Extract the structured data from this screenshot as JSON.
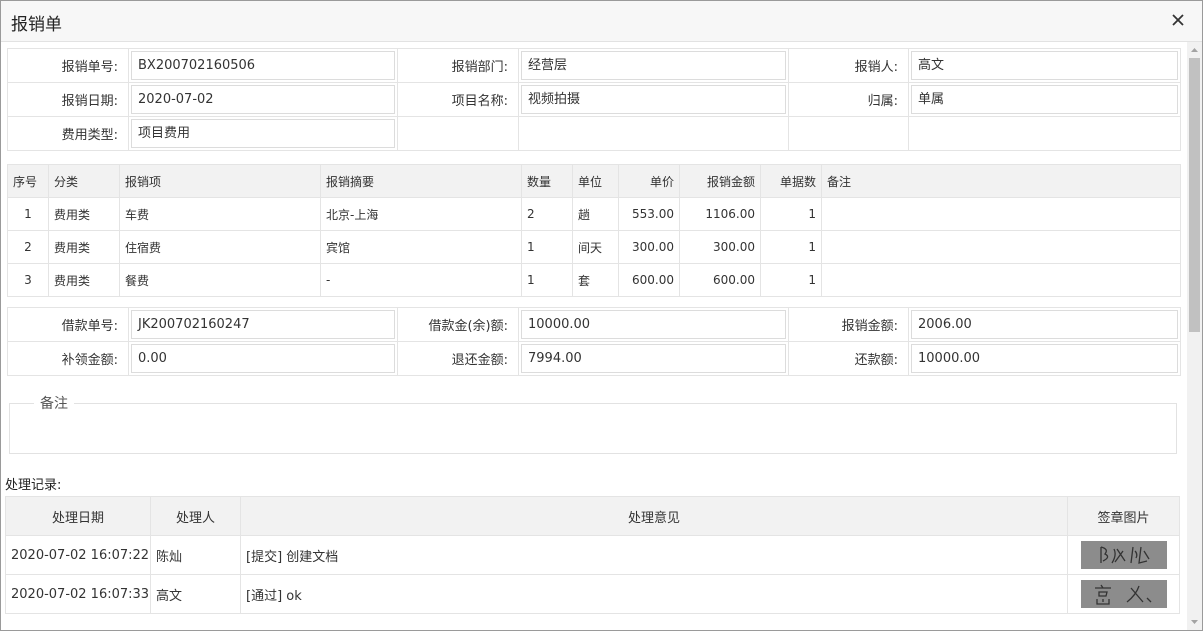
{
  "dialog": {
    "title": "报销单"
  },
  "form": {
    "no_label": "报销单号:",
    "no_value": "BX200702160506",
    "dept_label": "报销部门:",
    "dept_value": "经营层",
    "person_label": "报销人:",
    "person_value": "高文",
    "date_label": "报销日期:",
    "date_value": "2020-07-02",
    "project_label": "项目名称:",
    "project_value": "视频拍摄",
    "belong_label": "归属:",
    "belong_value": "单属",
    "type_label": "费用类型:",
    "type_value": "项目费用"
  },
  "items": {
    "headers": [
      "序号",
      "分类",
      "报销项",
      "报销摘要",
      "数量",
      "单位",
      "单价",
      "报销金额",
      "单据数",
      "备注"
    ],
    "rows": [
      [
        "1",
        "费用类",
        "车费",
        "北京-上海",
        "2",
        "趟",
        "553.00",
        "1106.00",
        "1",
        ""
      ],
      [
        "2",
        "费用类",
        "住宿费",
        "宾馆",
        "1",
        "间天",
        "300.00",
        "300.00",
        "1",
        ""
      ],
      [
        "3",
        "费用类",
        "餐费",
        "-",
        "1",
        "套",
        "600.00",
        "600.00",
        "1",
        ""
      ]
    ]
  },
  "loan": {
    "no_label": "借款单号:",
    "no_value": "JK200702160247",
    "balance_label": "借款金(余)额:",
    "balance_value": "10000.00",
    "claim_label": "报销金额:",
    "claim_value": "2006.00",
    "supp_label": "补领金额:",
    "supp_value": "0.00",
    "refund_label": "退还金额:",
    "refund_value": "7994.00",
    "repay_label": "还款额:",
    "repay_value": "10000.00"
  },
  "remarks": {
    "legend": "备注"
  },
  "records": {
    "label": "处理记录:",
    "headers": [
      "处理日期",
      "处理人",
      "处理意见",
      "签章图片"
    ],
    "rows": [
      {
        "date": "2020-07-02 16:07:22",
        "handler": "陈灿",
        "opinion": "[提交] 创建文档",
        "signature": "陈灿"
      },
      {
        "date": "2020-07-02 16:07:33",
        "handler": "高文",
        "opinion": "[通过] ok",
        "signature": "高文"
      }
    ]
  },
  "icons": {
    "close": "close-icon",
    "scroll_up": "arrow-up-icon",
    "scroll_down": "arrow-down-icon"
  },
  "colors": {
    "header_bg": "#f2f2f2",
    "border": "#e4e4e4",
    "title_bg": "#f7f7f7",
    "signature_bg": "#8c8c8c"
  }
}
